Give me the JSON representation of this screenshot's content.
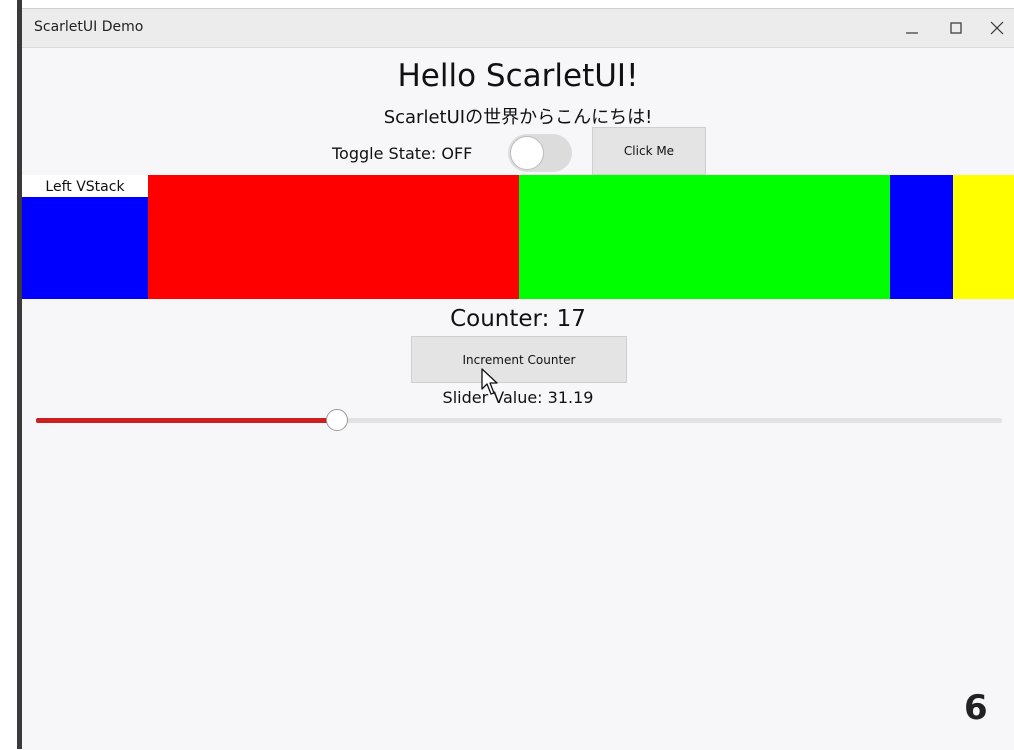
{
  "window": {
    "title": "ScarletUI Demo"
  },
  "main": {
    "heading": "Hello ScarletUI!",
    "subtitle": "ScarletUIの世界からこんにちは!",
    "toggle_label": "Toggle State: OFF",
    "toggle_on": false,
    "click_button_label": "Click Me",
    "left_vstack_label": "Left VStack",
    "counter_label": "Counter: 17",
    "increment_button_label": "Increment Counter",
    "slider_label": "Slider Value: 31.19",
    "slider_value_percent": 31.19
  },
  "colors": {
    "red": "#ff0000",
    "green": "#00ff00",
    "blue": "#0000ff",
    "yellow": "#ffff00",
    "slider_fill": "#cc1f1f"
  },
  "overlay": {
    "frame_number": "6"
  }
}
